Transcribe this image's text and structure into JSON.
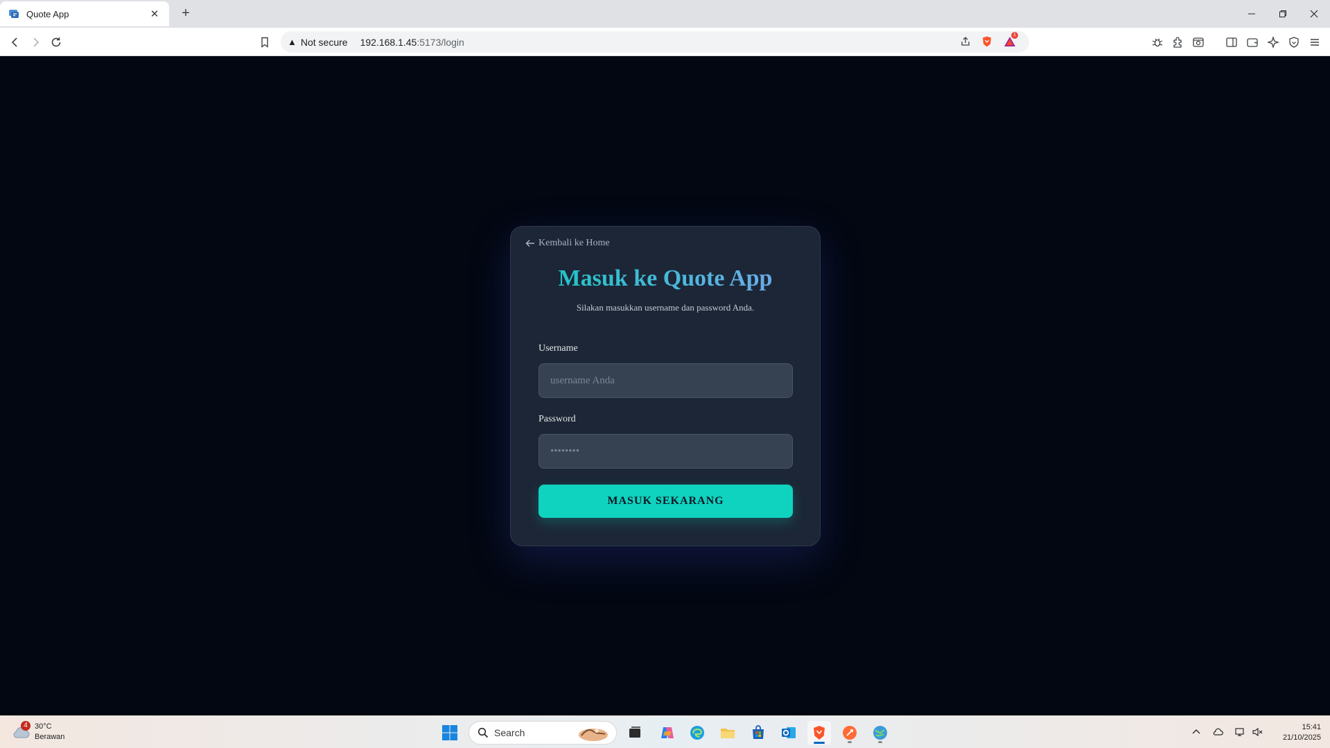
{
  "browser": {
    "tab_title": "Quote App",
    "new_tab": "+",
    "security_label": "Not secure",
    "url_host": "192.168.1.45",
    "url_path": ":5173/login",
    "notification_count": "1"
  },
  "login": {
    "back_link": "Kembali ke Home",
    "title": "Masuk ke Quote App",
    "subtitle": "Silakan masukkan username dan password Anda.",
    "username_label": "Username",
    "username_placeholder": "username Anda",
    "password_label": "Password",
    "password_placeholder": "••••••••",
    "submit_label": "MASUK SEKARANG"
  },
  "taskbar": {
    "weather_badge": "4",
    "temperature": "30°C",
    "condition": "Berawan",
    "search_label": "Search",
    "time": "15:41",
    "date": "21/10/2025"
  },
  "colors": {
    "page_bg": "#030712",
    "card_bg": "#1c2636",
    "accent": "#0fd3be",
    "title_gradient_start": "#14c9c0",
    "title_gradient_end": "#7aa7f0"
  }
}
